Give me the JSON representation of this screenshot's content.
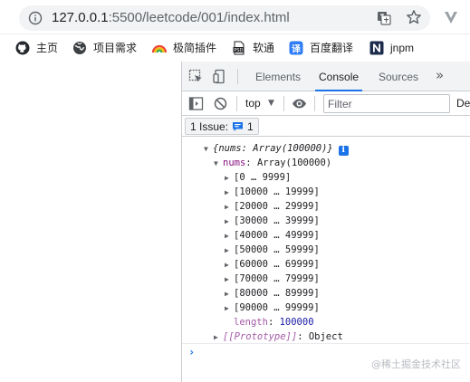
{
  "browser": {
    "url_host": "127.0.0.1",
    "url_rest": ":5500/leetcode/001/index.html"
  },
  "bookmarks": [
    {
      "label": "主页",
      "icon": "github-icon"
    },
    {
      "label": "项目需求",
      "icon": "globe-icon"
    },
    {
      "label": "极简插件",
      "icon": "rainbow-icon"
    },
    {
      "label": "软通",
      "icon": "psd-file-icon"
    },
    {
      "label": "百度翻译",
      "icon": "translate-icon"
    },
    {
      "label": "jnpm",
      "icon": "n-logo-icon"
    }
  ],
  "devtools": {
    "tabs": [
      "Elements",
      "Console",
      "Sources"
    ],
    "active_tab": "Console",
    "more_tabs": "»",
    "context": "top",
    "filter_placeholder": "Filter",
    "levels_label": "De",
    "issues_label": "1 Issue:",
    "issues_count": "1"
  },
  "console": {
    "summary": "{nums: Array(100000)}",
    "nums_key": "nums",
    "nums_value": "Array(100000)",
    "ranges": [
      "[0 … 9999]",
      "[10000 … 19999]",
      "[20000 … 29999]",
      "[30000 … 39999]",
      "[40000 … 49999]",
      "[50000 … 59999]",
      "[60000 … 69999]",
      "[70000 … 79999]",
      "[80000 … 89999]",
      "[90000 … 99999]"
    ],
    "length_key": "length",
    "length_value": "100000",
    "proto_key": "[[Prototype]]",
    "proto_value": "Object",
    "prompt": "›"
  },
  "watermark": "@稀土掘金技术社区",
  "colors": {
    "accent": "#1a73e8",
    "key_purple": "#881280",
    "number_blue": "#1a1aa6"
  }
}
